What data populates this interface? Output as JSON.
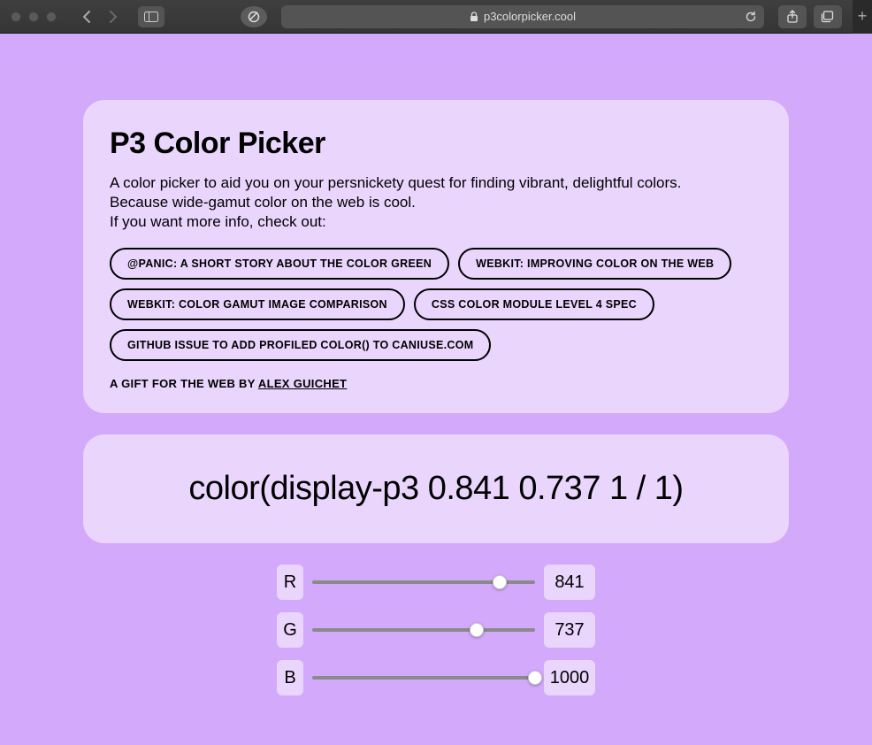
{
  "browser": {
    "url_host": "p3colorpicker.cool"
  },
  "header": {
    "title": "P3 Color Picker",
    "description_line1": "A color picker to aid you on your persnickety quest for finding vibrant, delightful colors.",
    "description_line2": "Because wide-gamut color on the web is cool.",
    "description_line3": "If you want more info, check out:",
    "links": [
      "@PANIC: A SHORT STORY ABOUT THE COLOR GREEN",
      "WEBKIT: IMPROVING COLOR ON THE WEB",
      "WEBKIT: COLOR GAMUT IMAGE COMPARISON",
      "CSS COLOR MODULE LEVEL 4 SPEC",
      "GITHUB ISSUE TO ADD PROFILED COLOR() TO CANIUSE.COM"
    ],
    "credit_prefix": "A GIFT FOR THE WEB BY ",
    "credit_author": "ALEX GUICHET"
  },
  "output": {
    "css_value": "color(display-p3 0.841 0.737 1 / 1)"
  },
  "sliders": {
    "r": {
      "label": "R",
      "value": "841",
      "pct": 84.1
    },
    "g": {
      "label": "G",
      "value": "737",
      "pct": 73.7
    },
    "b": {
      "label": "B",
      "value": "1000",
      "pct": 100
    }
  },
  "colors": {
    "page_bg": "#d3a9fb",
    "card_bg": "#ead5fd"
  }
}
